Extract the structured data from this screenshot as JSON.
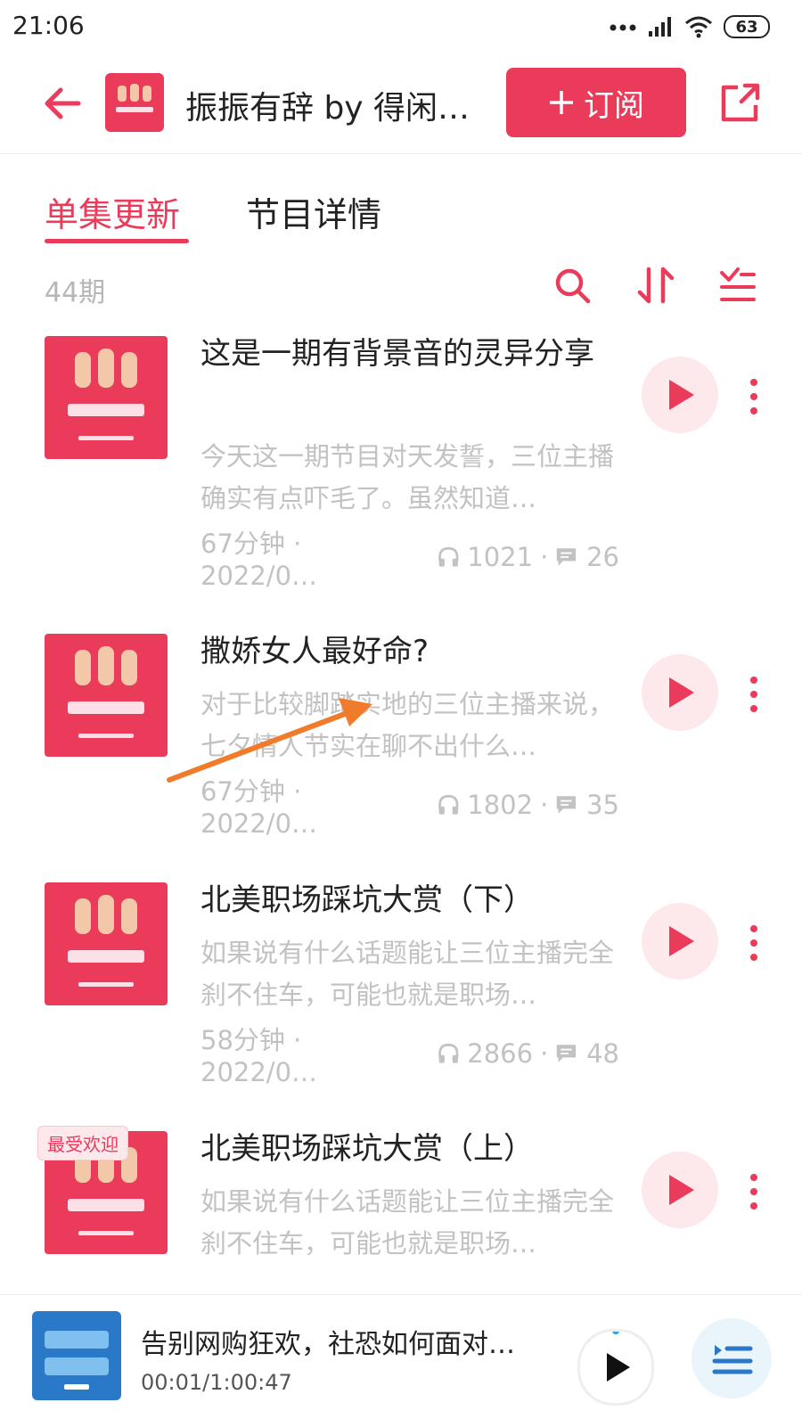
{
  "status": {
    "time": "21:06",
    "battery": "63"
  },
  "header": {
    "title": "振振有辞 by 得闲…",
    "subscribe_label": "订阅"
  },
  "tabs": [
    {
      "label": "单集更新",
      "active": true
    },
    {
      "label": "节目详情",
      "active": false
    }
  ],
  "list": {
    "count": "44期",
    "episodes": [
      {
        "title": "这是一期有背景音的灵异分享",
        "desc": "今天这一期节目对天发誓，三位主播确实有点吓毛了。虽然知道…",
        "duration_date": "67分钟 · 2022/0…",
        "plays": "1021",
        "comments": "26"
      },
      {
        "title": "撒娇女人最好命?",
        "desc": "对于比较脚踏实地的三位主播来说，七夕情人节实在聊不出什么…",
        "duration_date": "67分钟 · 2022/0…",
        "plays": "1802",
        "comments": "35"
      },
      {
        "title": "北美职场踩坑大赏（下）",
        "desc": "如果说有什么话题能让三位主播完全刹不住车，可能也就是职场…",
        "duration_date": "58分钟 · 2022/0…",
        "plays": "2866",
        "comments": "48"
      },
      {
        "title": "北美职场踩坑大赏（上）",
        "desc": "如果说有什么话题能让三位主播完全刹不住车，可能也就是职场…",
        "badge": "最受欢迎"
      }
    ]
  },
  "player": {
    "title": "告别网购狂欢，社恐如何面对…",
    "time": "00:01/1:00:47"
  },
  "colors": {
    "accent": "#ea3b5b",
    "muted": "#c2c2c2",
    "play_bg": "#fde8ec",
    "annotation_arrow": "#f07b2a"
  },
  "icons": [
    "back-arrow-icon",
    "plus-icon",
    "share-icon",
    "search-icon",
    "sort-icon",
    "filter-icon",
    "play-icon",
    "more-vertical-icon",
    "headphones-icon",
    "comment-icon",
    "playlist-icon",
    "signal-icon",
    "wifi-icon",
    "battery-icon"
  ]
}
